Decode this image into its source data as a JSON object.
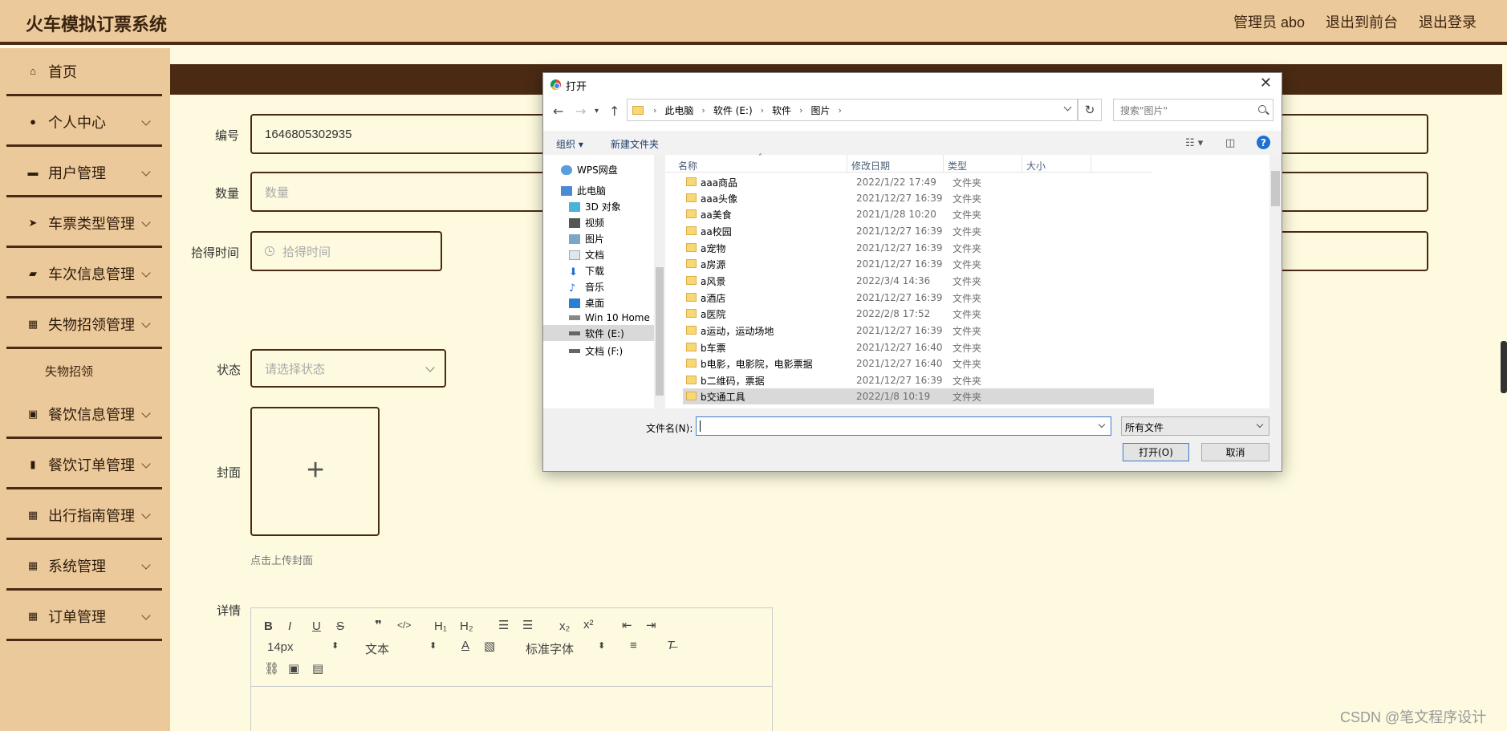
{
  "header": {
    "app_title": "火车模拟订票系统",
    "admin_label": "管理员 abo",
    "to_frontend": "退出到前台",
    "logout": "退出登录"
  },
  "sidebar": {
    "items": [
      {
        "label": "首页",
        "icon": "home-icon"
      },
      {
        "label": "个人中心",
        "icon": "user-icon"
      },
      {
        "label": "用户管理",
        "icon": "briefcase-icon"
      },
      {
        "label": "车票类型管理",
        "icon": "send-icon"
      },
      {
        "label": "车次信息管理",
        "icon": "ticket-icon"
      },
      {
        "label": "失物招领管理",
        "icon": "grid-icon"
      },
      {
        "label": "餐饮信息管理",
        "icon": "clipboard-icon"
      },
      {
        "label": "餐饮订单管理",
        "icon": "bar-chart-icon"
      },
      {
        "label": "出行指南管理",
        "icon": "grid-icon"
      },
      {
        "label": "系统管理",
        "icon": "grid-icon"
      },
      {
        "label": "订单管理",
        "icon": "grid-icon"
      }
    ],
    "sub_item": "失物招领"
  },
  "form": {
    "code_label": "编号",
    "code_value": "1646805302935",
    "qty_label": "数量",
    "qty_placeholder": "数量",
    "time_label": "拾得时间",
    "time_placeholder": "拾得时间",
    "status_label": "状态",
    "status_placeholder": "请选择状态",
    "cover_label": "封面",
    "cover_hint": "点击上传封面",
    "detail_label": "详情"
  },
  "editor": {
    "font_size": "14px",
    "block_type": "文本",
    "font_family": "标准字体"
  },
  "dialog": {
    "title": "打开",
    "path": [
      "此电脑",
      "软件 (E:)",
      "软件",
      "图片"
    ],
    "search_placeholder": "搜索\"图片\"",
    "organize": "组织 ▾",
    "new_folder": "新建文件夹",
    "tree": [
      {
        "label": "WPS网盘",
        "icon": "cloud-icon"
      },
      {
        "label": "此电脑",
        "icon": "computer-icon"
      },
      {
        "label": "3D 对象",
        "icon": "cube-icon"
      },
      {
        "label": "视频",
        "icon": "video-icon"
      },
      {
        "label": "图片",
        "icon": "picture-icon"
      },
      {
        "label": "文档",
        "icon": "document-icon"
      },
      {
        "label": "下载",
        "icon": "download-icon"
      },
      {
        "label": "音乐",
        "icon": "music-icon"
      },
      {
        "label": "桌面",
        "icon": "desktop-icon"
      },
      {
        "label": "Win 10 Home ›",
        "icon": "drive-icon"
      },
      {
        "label": "软件 (E:)",
        "icon": "drive-icon"
      },
      {
        "label": "文档 (F:)",
        "icon": "drive-icon"
      }
    ],
    "columns": {
      "name": "名称",
      "date": "修改日期",
      "type": "类型",
      "size": "大小"
    },
    "files": [
      {
        "name": "aaa商品",
        "date": "2022/1/22 17:49",
        "type": "文件夹"
      },
      {
        "name": "aaa头像",
        "date": "2021/12/27 16:39",
        "type": "文件夹"
      },
      {
        "name": "aa美食",
        "date": "2021/1/28 10:20",
        "type": "文件夹"
      },
      {
        "name": "aa校园",
        "date": "2021/12/27 16:39",
        "type": "文件夹"
      },
      {
        "name": "a宠物",
        "date": "2021/12/27 16:39",
        "type": "文件夹"
      },
      {
        "name": "a房源",
        "date": "2021/12/27 16:39",
        "type": "文件夹"
      },
      {
        "name": "a风景",
        "date": "2022/3/4 14:36",
        "type": "文件夹"
      },
      {
        "name": "a酒店",
        "date": "2021/12/27 16:39",
        "type": "文件夹"
      },
      {
        "name": "a医院",
        "date": "2022/2/8 17:52",
        "type": "文件夹"
      },
      {
        "name": "a运动，运动场地",
        "date": "2021/12/27 16:39",
        "type": "文件夹"
      },
      {
        "name": "b车票",
        "date": "2021/12/27 16:40",
        "type": "文件夹"
      },
      {
        "name": "b电影，电影院，电影票据",
        "date": "2021/12/27 16:40",
        "type": "文件夹"
      },
      {
        "name": "b二维码，票据",
        "date": "2021/12/27 16:39",
        "type": "文件夹"
      },
      {
        "name": "b交通工具",
        "date": "2022/1/8 10:19",
        "type": "文件夹"
      }
    ],
    "filename_label": "文件名(N):",
    "filetype": "所有文件",
    "open_button": "打开(O)",
    "cancel_button": "取消"
  },
  "watermark": "CSDN @笔文程序设计"
}
